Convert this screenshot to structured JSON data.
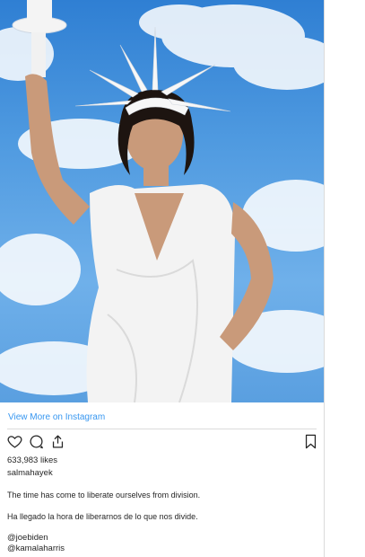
{
  "post": {
    "image_alt_icon": "photo-icon",
    "view_more_label": "View More on Instagram",
    "likes": "633,983 likes",
    "username": "salmahayek",
    "caption_en": "The time has come to liberate ourselves from division.",
    "caption_es": "Ha llegado la hora de liberarnos de lo que nos divide.",
    "mentions": [
      "@joebiden",
      "@kamalaharris"
    ]
  },
  "icons": {
    "like": "heart-icon",
    "comment": "comment-icon",
    "share": "share-icon",
    "save": "bookmark-icon"
  },
  "colors": {
    "link": "#3897f0",
    "text": "#262626",
    "border": "#dbdbdb",
    "sky": "#4f9ae0"
  }
}
